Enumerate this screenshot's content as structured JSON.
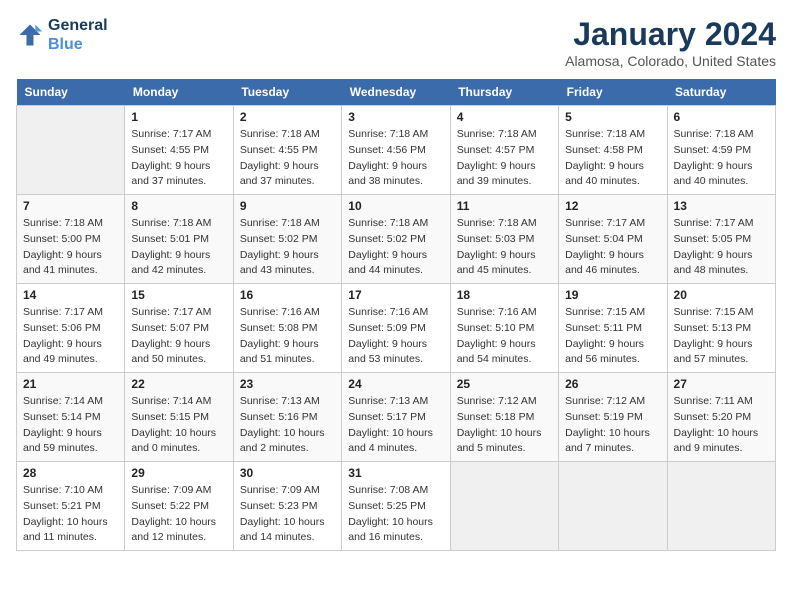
{
  "logo": {
    "line1": "General",
    "line2": "Blue"
  },
  "title": "January 2024",
  "subtitle": "Alamosa, Colorado, United States",
  "days_of_week": [
    "Sunday",
    "Monday",
    "Tuesday",
    "Wednesday",
    "Thursday",
    "Friday",
    "Saturday"
  ],
  "weeks": [
    [
      {
        "day": "",
        "info": ""
      },
      {
        "day": "1",
        "info": "Sunrise: 7:17 AM\nSunset: 4:55 PM\nDaylight: 9 hours\nand 37 minutes."
      },
      {
        "day": "2",
        "info": "Sunrise: 7:18 AM\nSunset: 4:55 PM\nDaylight: 9 hours\nand 37 minutes."
      },
      {
        "day": "3",
        "info": "Sunrise: 7:18 AM\nSunset: 4:56 PM\nDaylight: 9 hours\nand 38 minutes."
      },
      {
        "day": "4",
        "info": "Sunrise: 7:18 AM\nSunset: 4:57 PM\nDaylight: 9 hours\nand 39 minutes."
      },
      {
        "day": "5",
        "info": "Sunrise: 7:18 AM\nSunset: 4:58 PM\nDaylight: 9 hours\nand 40 minutes."
      },
      {
        "day": "6",
        "info": "Sunrise: 7:18 AM\nSunset: 4:59 PM\nDaylight: 9 hours\nand 40 minutes."
      }
    ],
    [
      {
        "day": "7",
        "info": "Sunrise: 7:18 AM\nSunset: 5:00 PM\nDaylight: 9 hours\nand 41 minutes."
      },
      {
        "day": "8",
        "info": "Sunrise: 7:18 AM\nSunset: 5:01 PM\nDaylight: 9 hours\nand 42 minutes."
      },
      {
        "day": "9",
        "info": "Sunrise: 7:18 AM\nSunset: 5:02 PM\nDaylight: 9 hours\nand 43 minutes."
      },
      {
        "day": "10",
        "info": "Sunrise: 7:18 AM\nSunset: 5:02 PM\nDaylight: 9 hours\nand 44 minutes."
      },
      {
        "day": "11",
        "info": "Sunrise: 7:18 AM\nSunset: 5:03 PM\nDaylight: 9 hours\nand 45 minutes."
      },
      {
        "day": "12",
        "info": "Sunrise: 7:17 AM\nSunset: 5:04 PM\nDaylight: 9 hours\nand 46 minutes."
      },
      {
        "day": "13",
        "info": "Sunrise: 7:17 AM\nSunset: 5:05 PM\nDaylight: 9 hours\nand 48 minutes."
      }
    ],
    [
      {
        "day": "14",
        "info": "Sunrise: 7:17 AM\nSunset: 5:06 PM\nDaylight: 9 hours\nand 49 minutes."
      },
      {
        "day": "15",
        "info": "Sunrise: 7:17 AM\nSunset: 5:07 PM\nDaylight: 9 hours\nand 50 minutes."
      },
      {
        "day": "16",
        "info": "Sunrise: 7:16 AM\nSunset: 5:08 PM\nDaylight: 9 hours\nand 51 minutes."
      },
      {
        "day": "17",
        "info": "Sunrise: 7:16 AM\nSunset: 5:09 PM\nDaylight: 9 hours\nand 53 minutes."
      },
      {
        "day": "18",
        "info": "Sunrise: 7:16 AM\nSunset: 5:10 PM\nDaylight: 9 hours\nand 54 minutes."
      },
      {
        "day": "19",
        "info": "Sunrise: 7:15 AM\nSunset: 5:11 PM\nDaylight: 9 hours\nand 56 minutes."
      },
      {
        "day": "20",
        "info": "Sunrise: 7:15 AM\nSunset: 5:13 PM\nDaylight: 9 hours\nand 57 minutes."
      }
    ],
    [
      {
        "day": "21",
        "info": "Sunrise: 7:14 AM\nSunset: 5:14 PM\nDaylight: 9 hours\nand 59 minutes."
      },
      {
        "day": "22",
        "info": "Sunrise: 7:14 AM\nSunset: 5:15 PM\nDaylight: 10 hours\nand 0 minutes."
      },
      {
        "day": "23",
        "info": "Sunrise: 7:13 AM\nSunset: 5:16 PM\nDaylight: 10 hours\nand 2 minutes."
      },
      {
        "day": "24",
        "info": "Sunrise: 7:13 AM\nSunset: 5:17 PM\nDaylight: 10 hours\nand 4 minutes."
      },
      {
        "day": "25",
        "info": "Sunrise: 7:12 AM\nSunset: 5:18 PM\nDaylight: 10 hours\nand 5 minutes."
      },
      {
        "day": "26",
        "info": "Sunrise: 7:12 AM\nSunset: 5:19 PM\nDaylight: 10 hours\nand 7 minutes."
      },
      {
        "day": "27",
        "info": "Sunrise: 7:11 AM\nSunset: 5:20 PM\nDaylight: 10 hours\nand 9 minutes."
      }
    ],
    [
      {
        "day": "28",
        "info": "Sunrise: 7:10 AM\nSunset: 5:21 PM\nDaylight: 10 hours\nand 11 minutes."
      },
      {
        "day": "29",
        "info": "Sunrise: 7:09 AM\nSunset: 5:22 PM\nDaylight: 10 hours\nand 12 minutes."
      },
      {
        "day": "30",
        "info": "Sunrise: 7:09 AM\nSunset: 5:23 PM\nDaylight: 10 hours\nand 14 minutes."
      },
      {
        "day": "31",
        "info": "Sunrise: 7:08 AM\nSunset: 5:25 PM\nDaylight: 10 hours\nand 16 minutes."
      },
      {
        "day": "",
        "info": ""
      },
      {
        "day": "",
        "info": ""
      },
      {
        "day": "",
        "info": ""
      }
    ]
  ]
}
